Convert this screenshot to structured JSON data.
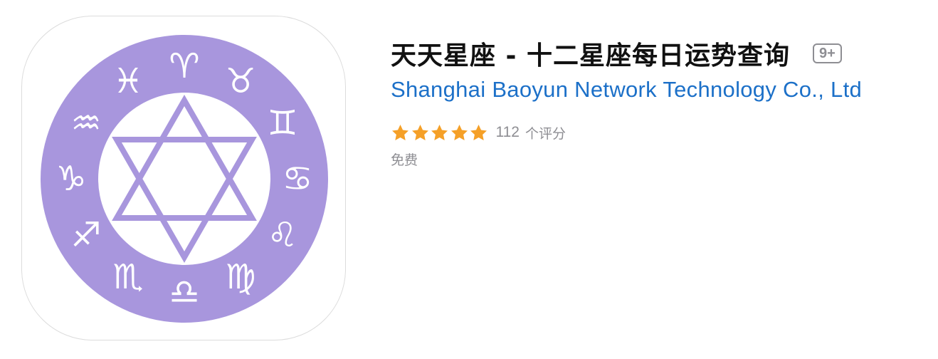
{
  "app": {
    "title": "天天星座 - 十二星座每日运势查询",
    "age_rating": "9+",
    "developer": "Shanghai Baoyun Network Technology Co., Ltd",
    "rating": {
      "stars": 5,
      "max_stars": 5,
      "count": "112",
      "label": "个评分"
    },
    "price": "免费"
  },
  "icon": {
    "wheel_color": "#a896dd",
    "zodiac_glyphs": {
      "aries": "♈",
      "taurus": "♉",
      "gemini": "♊",
      "cancer": "♋",
      "leo": "♌",
      "virgo": "♍",
      "libra": "♎",
      "scorpio": "♏",
      "sagittarius": "♐",
      "capricorn": "♑",
      "aquarius": "♒",
      "pisces": "♓"
    }
  },
  "colors": {
    "developer_link": "#1c70c8",
    "star": "#f5a028",
    "secondary_text": "#8e8e93"
  }
}
